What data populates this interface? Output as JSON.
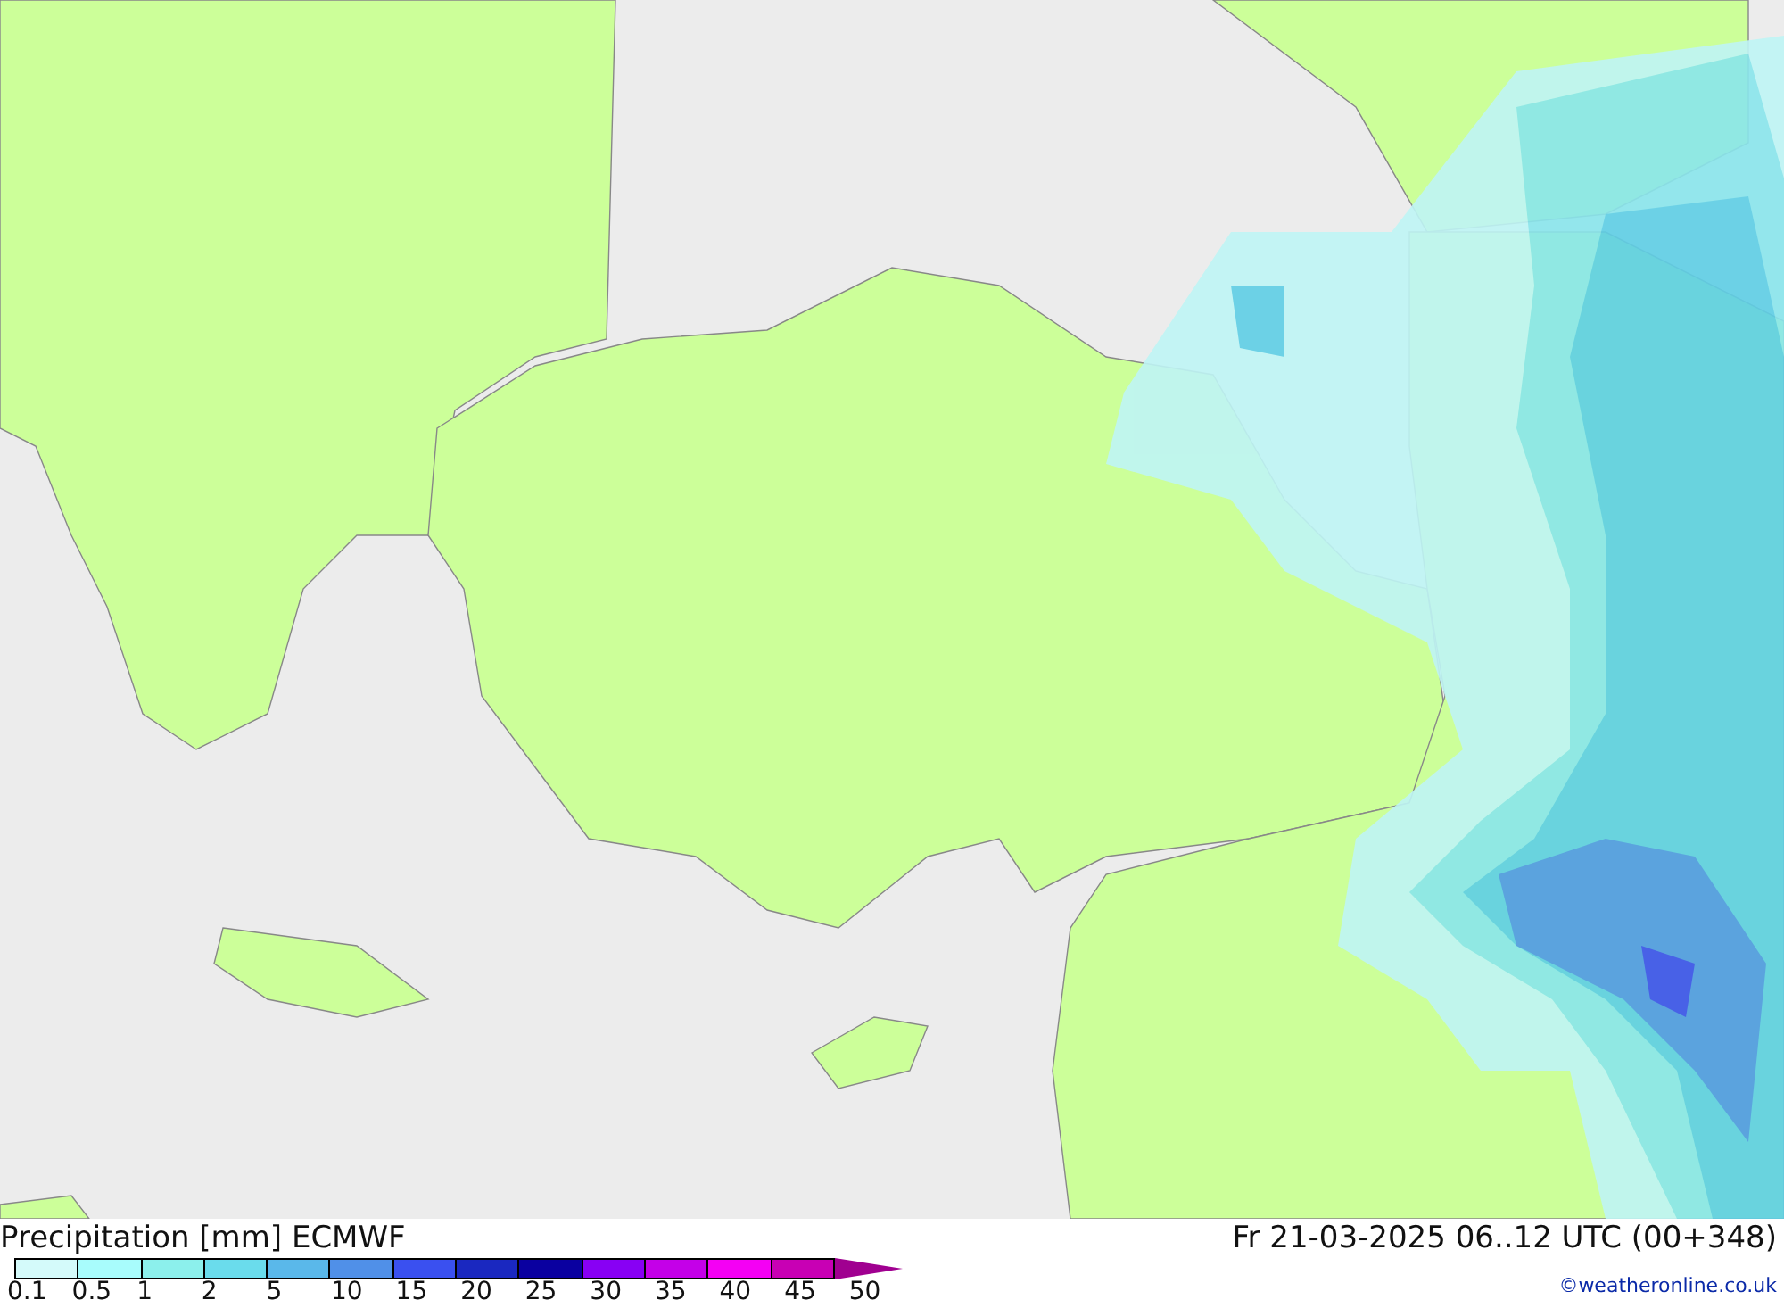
{
  "legend": {
    "title": "Precipitation [mm] ECMWF",
    "timestamp": "Fr 21-03-2025 06..12 UTC (00+348)",
    "bins": [
      {
        "color": "#d4fafa"
      },
      {
        "color": "#a8fcfc"
      },
      {
        "color": "#8cf0ec"
      },
      {
        "color": "#6adcec"
      },
      {
        "color": "#5ab8ea"
      },
      {
        "color": "#5090e8"
      },
      {
        "color": "#3a50f0"
      },
      {
        "color": "#1a28c0"
      },
      {
        "color": "#0a00a0"
      },
      {
        "color": "#8800f4"
      },
      {
        "color": "#c400e8"
      },
      {
        "color": "#f400f4"
      },
      {
        "color": "#c800b4"
      },
      {
        "kind": "arrow",
        "color": "#a00090"
      }
    ],
    "labels": [
      "0.1",
      "0.5",
      "1",
      "2",
      "5",
      "10",
      "15",
      "20",
      "25",
      "30",
      "35",
      "40",
      "45",
      "50"
    ],
    "credit": "©weatheronline.co.uk"
  }
}
